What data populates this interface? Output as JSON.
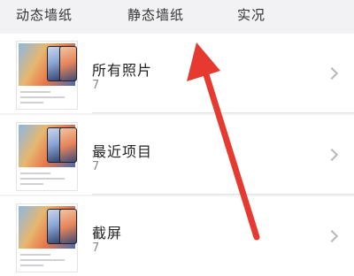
{
  "tabs": [
    {
      "label": "动态墙纸"
    },
    {
      "label": "静态墙纸"
    },
    {
      "label": "实况"
    }
  ],
  "albums": [
    {
      "title": "所有照片",
      "count": "7"
    },
    {
      "title": "最近项目",
      "count": "7"
    },
    {
      "title": "截屏",
      "count": "7"
    }
  ],
  "colors": {
    "annotation_arrow": "#e6392f",
    "background": "#f2f2f4"
  },
  "icons": {
    "chevron": "chevron-right-icon"
  }
}
